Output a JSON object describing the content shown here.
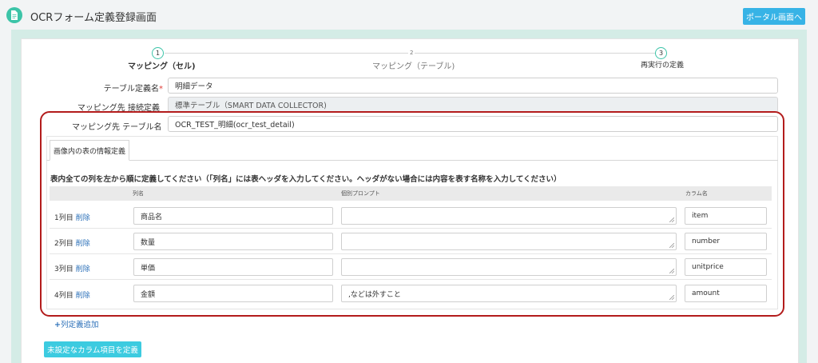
{
  "header": {
    "title": "OCRフォーム定義登録画面",
    "portal_button": "ポータル画面へ",
    "accent_color": "#3cc4a8"
  },
  "steps": [
    {
      "num": "1",
      "label": "マッピング（セル)",
      "state": "active"
    },
    {
      "num": "2",
      "label": "マッピング（テーブル)",
      "state": "inactive"
    },
    {
      "num": "3",
      "label": "再実行の定義",
      "state": "upcoming"
    }
  ],
  "form": {
    "table_def_label": "テーブル定義名",
    "required_mark": "*",
    "table_def_value": "明細データ",
    "dest_conn_label": "マッピング先 接続定義",
    "dest_conn_value": "標準テーブル（SMART DATA COLLECTOR)",
    "dest_table_label": "マッピング先 テーブル名",
    "dest_table_value": "OCR_TEST_明細(ocr_test_detail)"
  },
  "tab": {
    "label": "画像内の表の情報定義"
  },
  "instruction": "表内全ての列を左から順に定義してください（「列名」には表ヘッダを入力してください。ヘッダがない場合には内容を表す名称を入力してください）",
  "table": {
    "headers": [
      "列名",
      "個別プロンプト",
      "カラム名"
    ],
    "delete_label": "削除",
    "rows": [
      {
        "label": "1列目",
        "name": "商品名",
        "prompt": "",
        "column": "item"
      },
      {
        "label": "2列目",
        "name": "数量",
        "prompt": "",
        "column": "number"
      },
      {
        "label": "3列目",
        "name": "単価",
        "prompt": "",
        "column": "unitprice"
      },
      {
        "label": "4列目",
        "name": "金額",
        "prompt": ",などは外すこと",
        "column": "amount"
      }
    ]
  },
  "add_column_link": {
    "plus": "+",
    "label": "列定義追加"
  },
  "undefined_columns_button": "未設定なカラム項目を定義",
  "colors": {
    "highlight_frame": "#b31c1c",
    "link": "#2a6fb8",
    "primary_button": "#37b3e6"
  }
}
